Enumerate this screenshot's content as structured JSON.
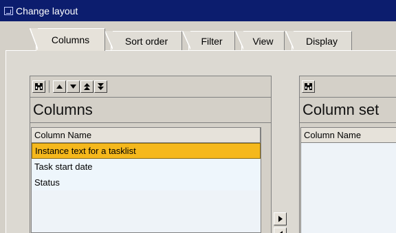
{
  "window": {
    "title": "Change layout"
  },
  "tabs": [
    {
      "label": "Columns",
      "active": true
    },
    {
      "label": "Sort order",
      "active": false
    },
    {
      "label": "Filter",
      "active": false
    },
    {
      "label": "View",
      "active": false
    },
    {
      "label": "Display",
      "active": false
    }
  ],
  "left_panel": {
    "toolbar_icons": [
      "binoculars-icon",
      "arrow-up-icon",
      "arrow-down-icon",
      "move-top-icon",
      "move-bottom-icon"
    ],
    "title": "Columns",
    "column_header": "Column Name",
    "rows": [
      "Instance text for a tasklist",
      "Task start date",
      "Status"
    ],
    "selected_row": 0
  },
  "right_panel": {
    "toolbar_icons": [
      "binoculars-icon"
    ],
    "title": "Column set",
    "column_header": "Column Name"
  },
  "move_buttons": [
    "move-right-icon",
    "move-left-icon"
  ],
  "colors": {
    "titlebar": "#0c1d6e",
    "selection": "#f5b81c",
    "list_background": "#eef6fc"
  }
}
